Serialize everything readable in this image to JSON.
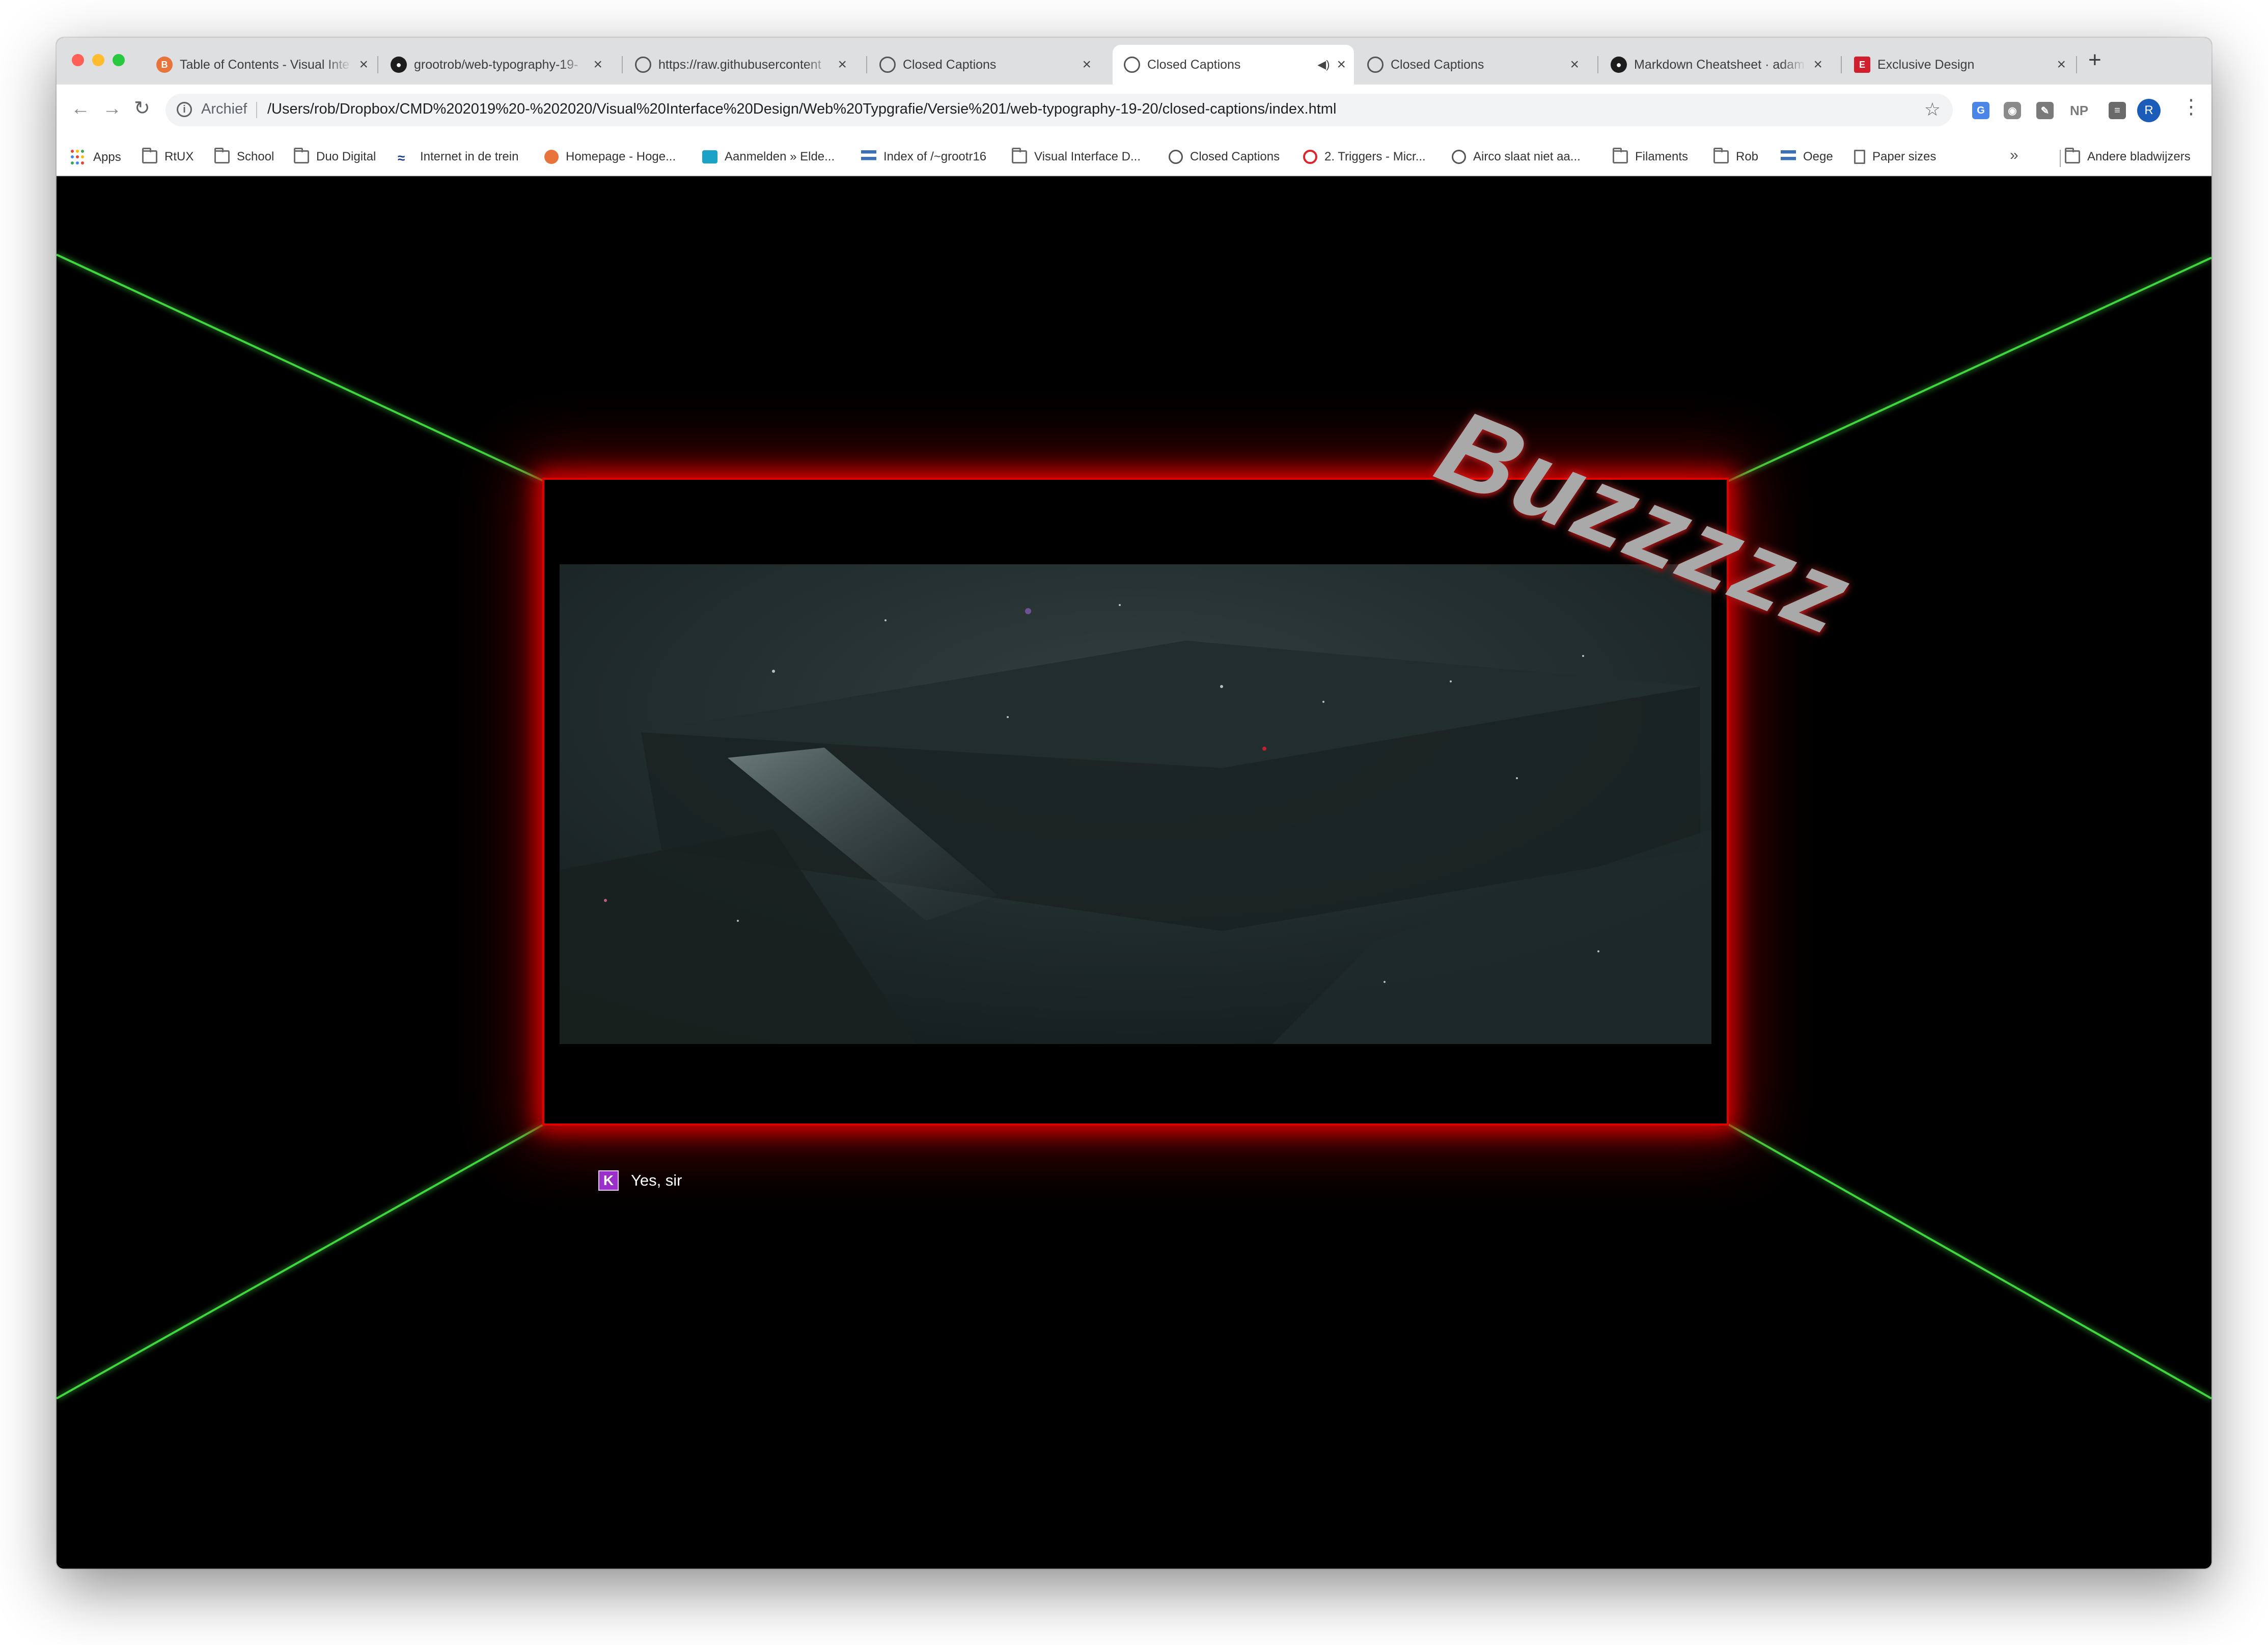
{
  "browser": {
    "tabs": [
      {
        "title": "Table of Contents - Visual Inte",
        "favicon": "blogger-icon",
        "active": false
      },
      {
        "title": "grootrob/web-typography-19-",
        "favicon": "github-icon",
        "active": false
      },
      {
        "title": "https://raw.githubusercontent",
        "favicon": "globe-icon",
        "active": false
      },
      {
        "title": "Closed Captions",
        "favicon": "globe-icon",
        "active": false
      },
      {
        "title": "Closed Captions",
        "favicon": "globe-icon",
        "active": true
      },
      {
        "title": "Closed Captions",
        "favicon": "globe-icon",
        "active": false
      },
      {
        "title": "Markdown Cheatsheet · adam-",
        "favicon": "github-icon",
        "active": false
      },
      {
        "title": "Exclusive Design",
        "favicon": "exclusive-design-icon",
        "active": false
      }
    ],
    "new_tab": "+",
    "close_glyph": "×",
    "address": {
      "scheme_label": "Archief",
      "url": "/Users/rob/Dropbox/CMD%202019%20-%202020/Visual%20Interface%20Design/Web%20Typgrafie/Versie%201/web-typography-19-20/closed-captions/index.html"
    },
    "extensions": {
      "np_label": "NP",
      "avatar_letter": "R"
    },
    "bookmarks": [
      {
        "label": "Apps",
        "icon": "apps-icon"
      },
      {
        "label": "RtUX",
        "icon": "folder-icon"
      },
      {
        "label": "School",
        "icon": "folder-icon"
      },
      {
        "label": "Duo Digital",
        "icon": "folder-icon"
      },
      {
        "label": "Internet in de trein",
        "icon": "train-icon"
      },
      {
        "label": "Homepage - Hoge...",
        "icon": "blogger-icon"
      },
      {
        "label": "Aanmelden » Elde...",
        "icon": "site-icon"
      },
      {
        "label": "Index of /~grootr16",
        "icon": "site-icon"
      },
      {
        "label": "Visual Interface D...",
        "icon": "folder-icon"
      },
      {
        "label": "Closed Captions",
        "icon": "globe-icon"
      },
      {
        "label": "2. Triggers - Micr...",
        "icon": "opera-icon"
      },
      {
        "label": "Airco slaat niet aa...",
        "icon": "globe-icon"
      },
      {
        "label": "Filaments",
        "icon": "folder-icon"
      },
      {
        "label": "Rob",
        "icon": "folder-icon"
      },
      {
        "label": "Oege",
        "icon": "site-icon"
      },
      {
        "label": "Paper sizes",
        "icon": "page-icon"
      }
    ],
    "bookmarks_overflow": "»",
    "other_bookmarks": "Andere bladwijzers"
  },
  "page": {
    "effect_word": "Buzzzzz",
    "caption": {
      "speaker": "K",
      "text": "Yes, sir"
    },
    "colors": {
      "frame_glow": "#e10000",
      "laser_lines": "#3fd63f",
      "speaker_badge": "#9b2fc9"
    }
  }
}
